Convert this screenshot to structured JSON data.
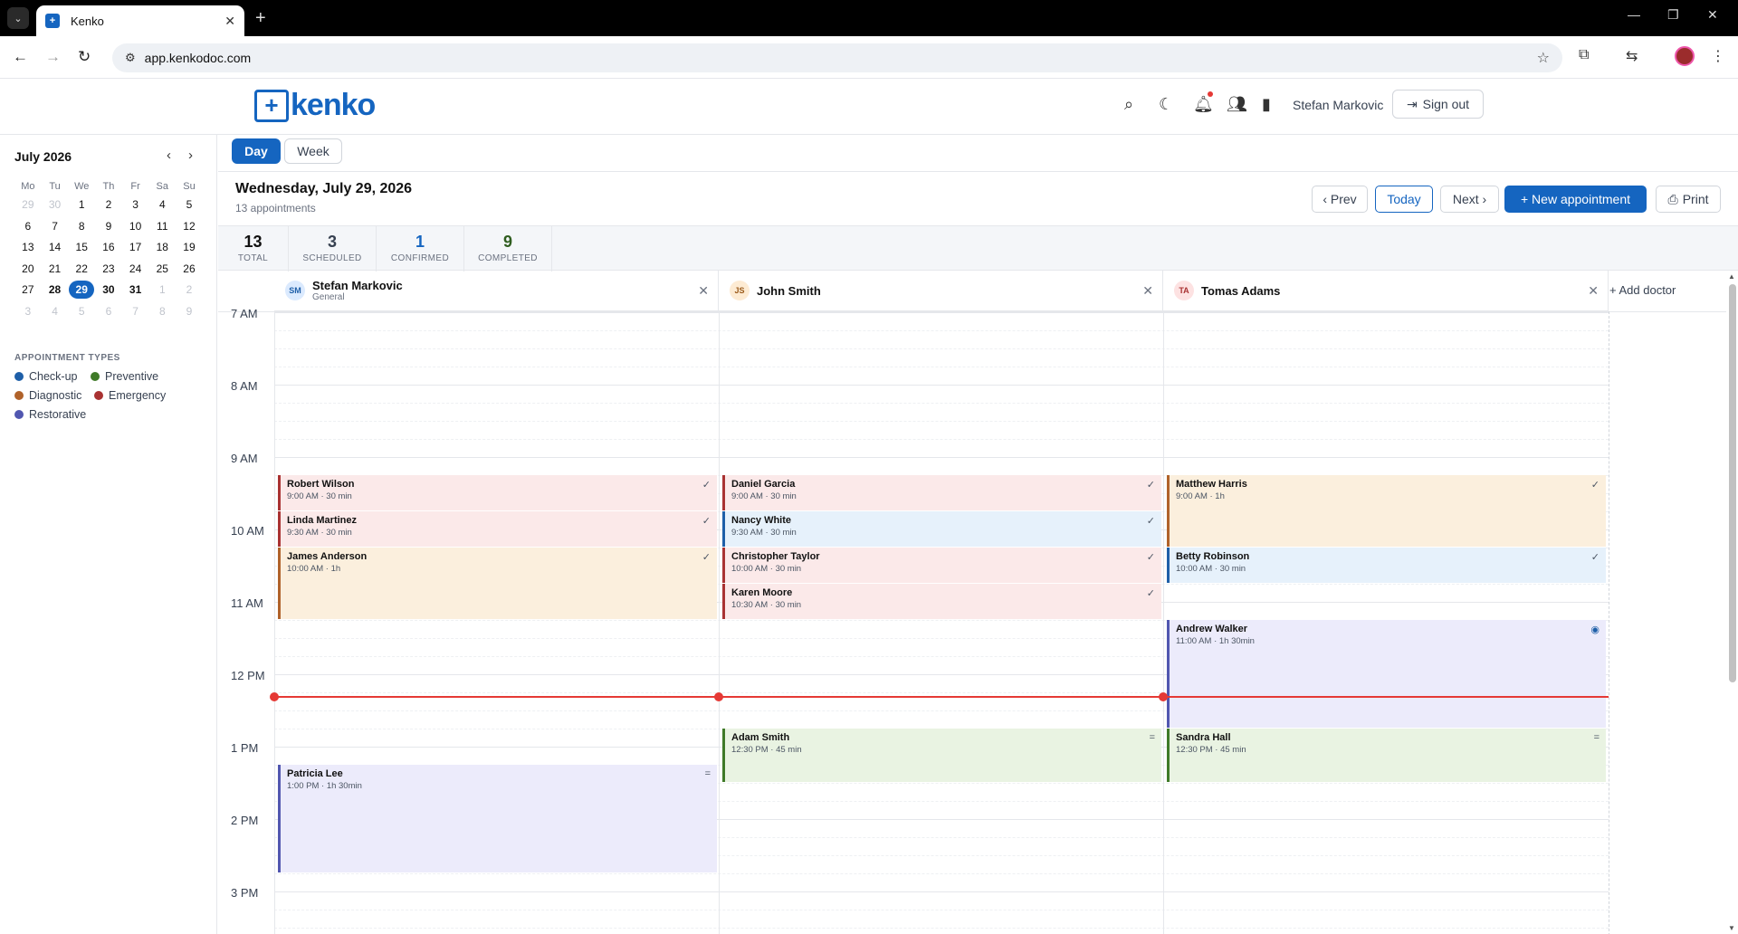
{
  "browser": {
    "tab_title": "Kenko",
    "tab_favicon": "+",
    "url": "app.kenkodoc.com",
    "new_tab": "+",
    "close_tab": "✕"
  },
  "header": {
    "logo_text": "kenko",
    "user_name": "Stefan Markovic",
    "sign_out": "Sign out",
    "icons": [
      "search-icon",
      "moon-icon",
      "bell-icon",
      "users-icon",
      "chart-icon"
    ]
  },
  "mini_calendar": {
    "title": "July 2026",
    "weekdays": [
      "Mo",
      "Tu",
      "We",
      "Th",
      "Fr",
      "Sa",
      "Su"
    ],
    "selected": "29"
  },
  "legend": {
    "title": "APPOINTMENT TYPES",
    "types": [
      {
        "label": "Check-up",
        "color": "#1e5fa8"
      },
      {
        "label": "Preventive",
        "color": "#3f7a28"
      },
      {
        "label": "Diagnostic",
        "color": "#b0622a"
      },
      {
        "label": "Emergency",
        "color": "#a93232"
      },
      {
        "label": "Restorative",
        "color": "#5157b0"
      }
    ]
  },
  "toolbar": {
    "day": "Day",
    "week": "Week",
    "date": "Wednesday, July 29, 2026",
    "count": "13 appointments",
    "prev": "‹ Prev",
    "today": "Today",
    "next": "Next ›",
    "new_appointment": "+  New appointment",
    "print": "Print"
  },
  "stats": [
    {
      "value": "13",
      "label": "TOTAL",
      "color": "#111111"
    },
    {
      "value": "3",
      "label": "SCHEDULED",
      "color": "#374151"
    },
    {
      "value": "1",
      "label": "CONFIRMED",
      "color": "#1565c0"
    },
    {
      "value": "9",
      "label": "COMPLETED",
      "color": "#2f5d1f"
    }
  ],
  "doctors": [
    {
      "initials": "SM",
      "name": "Stefan Markovic",
      "specialty": "General"
    },
    {
      "initials": "JS",
      "name": "John Smith",
      "specialty": ""
    },
    {
      "initials": "TA",
      "name": "Tomas Adams",
      "specialty": ""
    }
  ],
  "add_doctor": "+  Add doctor",
  "hours": [
    "7 AM",
    "8 AM",
    "9 AM",
    "10 AM",
    "11 AM",
    "12 PM",
    "1 PM",
    "2 PM",
    "3 PM"
  ],
  "appointments": {
    "a1": {
      "name": "Robert Wilson",
      "time": "9:00 AM · 30 min",
      "status": "✓"
    },
    "a2": {
      "name": "Linda Martinez",
      "time": "9:30 AM · 30 min",
      "status": "✓"
    },
    "a3": {
      "name": "James Anderson",
      "time": "10:00 AM · 1h",
      "status": "✓"
    },
    "a4": {
      "name": "Patricia Lee",
      "time": "1:00 PM · 1h 30min",
      "status": "="
    },
    "b1": {
      "name": "Daniel Garcia",
      "time": "9:00 AM · 30 min",
      "status": "✓"
    },
    "b2": {
      "name": "Nancy White",
      "time": "9:30 AM · 30 min",
      "status": "✓"
    },
    "b3": {
      "name": "Christopher Taylor",
      "time": "10:00 AM · 30 min",
      "status": "✓"
    },
    "b4": {
      "name": "Karen Moore",
      "time": "10:30 AM · 30 min",
      "status": "✓"
    },
    "b5": {
      "name": "Adam Smith",
      "time": "12:30 PM · 45 min",
      "status": "="
    },
    "c1": {
      "name": "Matthew Harris",
      "time": "9:00 AM · 1h",
      "status": "✓"
    },
    "c2": {
      "name": "Betty Robinson",
      "time": "10:00 AM · 30 min",
      "status": "✓"
    },
    "c3": {
      "name": "Andrew Walker",
      "time": "11:00 AM · 1h 30min",
      "status": "◉"
    },
    "c4": {
      "name": "Sandra Hall",
      "time": "12:30 PM · 45 min",
      "status": "="
    }
  }
}
